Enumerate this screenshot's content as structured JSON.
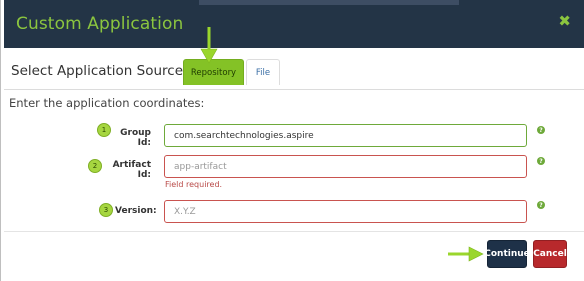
{
  "dialog": {
    "title": "Custom Application",
    "close_icon": "close-x-icon"
  },
  "source": {
    "label": "Select Application Source:",
    "tabs": [
      {
        "label": "Repository",
        "active": true
      },
      {
        "label": "File",
        "active": false
      }
    ]
  },
  "instructions": "Enter the application coordinates:",
  "fields": [
    {
      "step": "1",
      "label": "Group Id:",
      "value": "com.searchtechnologies.aspire",
      "placeholder": "",
      "state": "valid"
    },
    {
      "step": "2",
      "label": "Artifact Id:",
      "value": "",
      "placeholder": "app-artifact",
      "state": "error",
      "error": "Field required."
    },
    {
      "step": "3",
      "label": "Version:",
      "value": "",
      "placeholder": "X.Y.Z",
      "state": "error"
    }
  ],
  "buttons": {
    "continue": "Continue",
    "cancel": "Cancel"
  },
  "colors": {
    "header_bg": "#233446",
    "accent_green": "#8bc53f",
    "error_red": "#c9534f",
    "continue_bg": "#1e3148",
    "cancel_bg": "#b8292c",
    "annotation_arrow": "#9ad62c"
  }
}
